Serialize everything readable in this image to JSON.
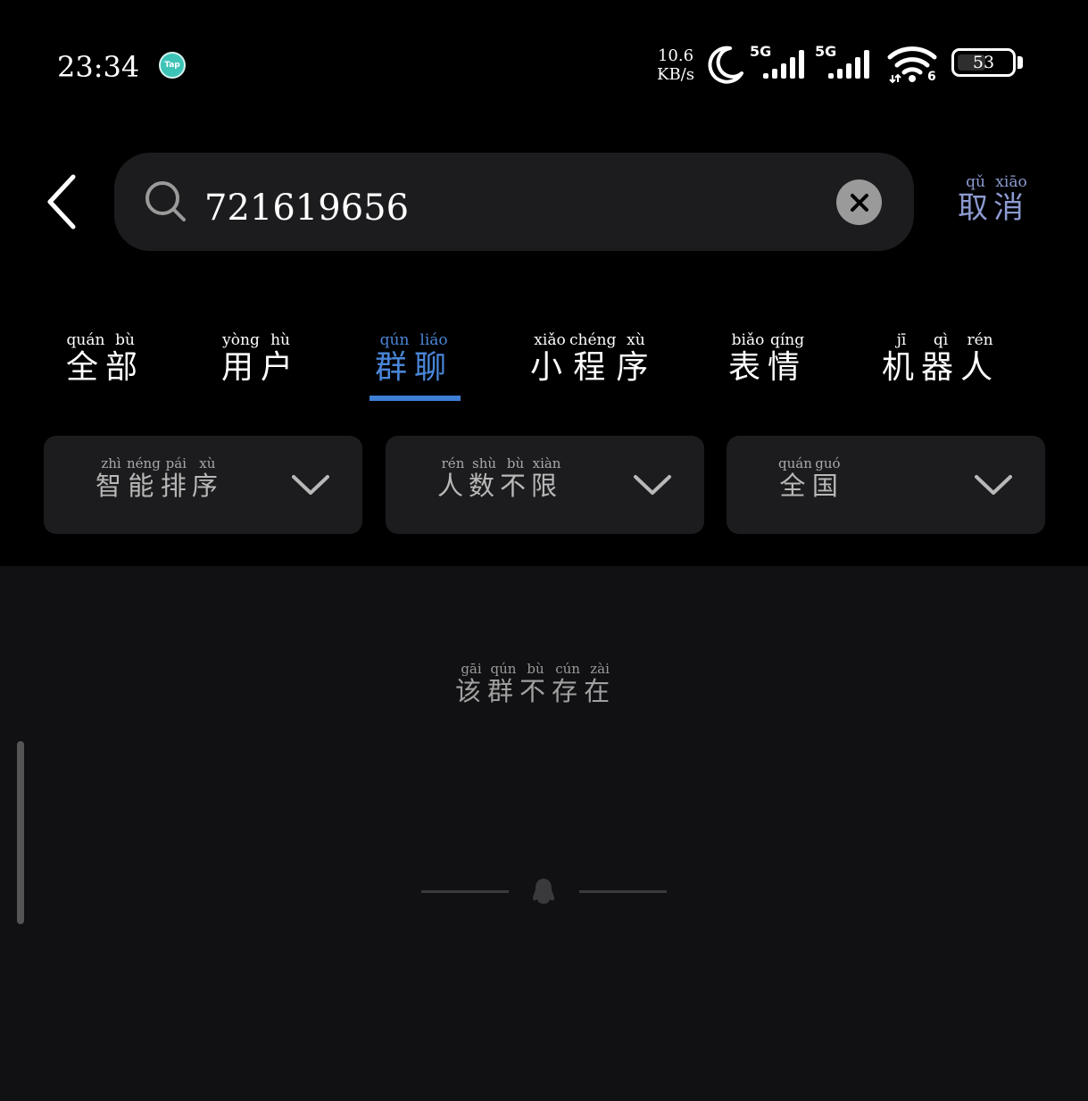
{
  "status_bar": {
    "time": "23:34",
    "app_badge": "Tap",
    "net_speed_value": "10.6",
    "net_speed_unit": "KB/s",
    "sim1_network": "5G",
    "sim2_network": "5G",
    "wifi_badge": "6",
    "battery_percent": "53",
    "battery_level": 0.53,
    "icons": [
      "moon-icon",
      "signal-icon",
      "wifi-icon",
      "battery-icon"
    ]
  },
  "search": {
    "query": "721619656",
    "cancel_label": "取消",
    "cancel_pinyin": [
      "qǔ",
      "xiāo"
    ],
    "cancel_chars": [
      "取",
      "消"
    ]
  },
  "tabs": [
    {
      "chars": [
        "全",
        "部"
      ],
      "pinyin": [
        "quán",
        "bù"
      ]
    },
    {
      "chars": [
        "用",
        "户"
      ],
      "pinyin": [
        "yòng",
        "hù"
      ]
    },
    {
      "chars": [
        "群",
        "聊"
      ],
      "pinyin": [
        "qún",
        "liáo"
      ],
      "active": true
    },
    {
      "chars": [
        "小",
        "程",
        "序"
      ],
      "pinyin": [
        "xiǎo",
        "chéng",
        "xù"
      ]
    },
    {
      "chars": [
        "表",
        "情"
      ],
      "pinyin": [
        "biǎo",
        "qíng"
      ]
    },
    {
      "chars": [
        "机",
        "器",
        "人"
      ],
      "pinyin": [
        "jī",
        "qì",
        "rén"
      ]
    }
  ],
  "filters": [
    {
      "chars": [
        "智",
        "能",
        "排",
        "序"
      ],
      "pinyin": [
        "zhì",
        "néng",
        "pái",
        "xù"
      ]
    },
    {
      "chars": [
        "人",
        "数",
        "不",
        "限"
      ],
      "pinyin": [
        "rén",
        "shù",
        "bù",
        "xiàn"
      ]
    },
    {
      "chars": [
        "全",
        "国"
      ],
      "pinyin": [
        "quán",
        "guó"
      ]
    }
  ],
  "result": {
    "chars": [
      "该",
      "群",
      "不",
      "存",
      "在"
    ],
    "pinyin": [
      "gāi",
      "qún",
      "bù",
      "cún",
      "zài"
    ]
  },
  "colors": {
    "accent": "#3f7fd6",
    "cancel": "#8c9ad0",
    "background": "#000000",
    "result_bg": "#111113"
  }
}
